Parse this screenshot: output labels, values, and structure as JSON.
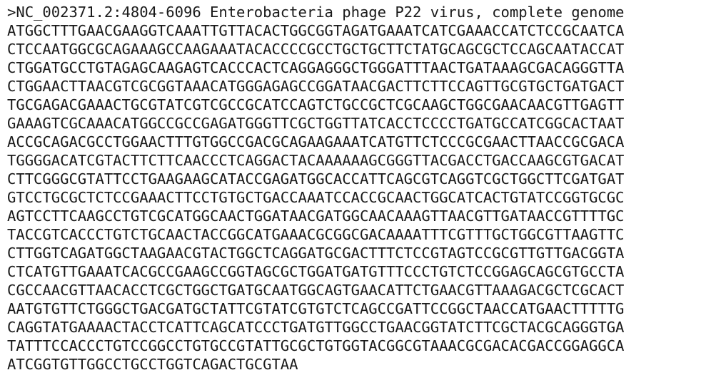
{
  "header": ">NC_002371.2:4804-6096 Enterobacteria phage P22 virus, complete genome",
  "sequence": [
    "ATGGCTTTGAACGAAGGTCAAATTGTTACACTGGCGGTAGATGAAATCATCGAAACCATCTCCGCAATCA",
    "CTCCAATGGCGCAGAAAGCCAAGAAATACACCCCGCCTGCTGCTTCTATGCAGCGCTCCAGCAATACCAT",
    "CTGGATGCCTGTAGAGCAAGAGTCACCCACTCAGGAGGGCTGGGATTTAACTGATAAAGCGACAGGGTTA",
    "CTGGAACTTAACGTCGCGGTAAACATGGGAGAGCCGGATAACGACTTCTTCCAGTTGCGTGCTGATGACT",
    "TGCGAGACGAAACTGCGTATCGTCGCCGCATCCAGTCTGCCGCTCGCAAGCTGGCGAACAACGTTGAGTT",
    "GAAAGTCGCAAACATGGCCGCCGAGATGGGTTCGCTGGTTATCACCTCCCCTGATGCCATCGGCACTAAT",
    "ACCGCAGACGCCTGGAACTTTGTGGCCGACGCAGAAGAAATCATGTTCTCCCGCGAACTTAACCGCGACA",
    "TGGGGACATCGTACTTCTTCAACCCTCAGGACTACAAAAAAGCGGGTTACGACCTGACCAAGCGTGACAT",
    "CTTCGGGCGTATTCCTGAAGAAGCATACCGAGATGGCACCATTCAGCGTCAGGTCGCTGGCTTCGATGAT",
    "GTCCTGCGCTCTCCGAAACTTCCTGTGCTGACCAAATCCACCGCAACTGGCATCACTGTATCCGGTGCGC",
    "AGTCCTTCAAGCCTGTCGCATGGCAACTGGATAACGATGGCAACAAAGTTAACGTTGATAACCGTTTTGC",
    "TACCGTCACCCTGTCTGCAACTACCGGCATGAAACGCGGCGACAAAATTTCGTTTGCTGGCGTTAAGTTC",
    "CTTGGTCAGATGGCTAAGAACGTACTGGCTCAGGATGCGACTTTCTCCGTAGTCCGCGTTGTTGACGGTA",
    "CTCATGTTGAAATCACGCCGAAGCCGGTAGCGCTGGATGATGTTTCCCTGTCTCCGGAGCAGCGTGCCTA",
    "CGCCAACGTTAACACCTCGCTGGCTGATGCAATGGCAGTGAACATTCTGAACGTTAAAGACGCTCGCACT",
    "AATGTGTTCTGGGCTGACGATGCTATTCGTATCGTGTCTCAGCCGATTCCGGCTAACCATGAACTTTTTG",
    "CAGGTATGAAAACTACCTCATTCAGCATCCCTGATGTTGGCCTGAACGGTATCTTCGCTACGCAGGGTGA",
    "TATTTCCACCCTGTCCGGCCTGTGCCGTATTGCGCTGTGGTACGGCGTAAACGCGACACGACCGGAGGCA",
    "ATCGGTGTTGGCCTGCCTGGTCAGACTGCGTAA"
  ]
}
